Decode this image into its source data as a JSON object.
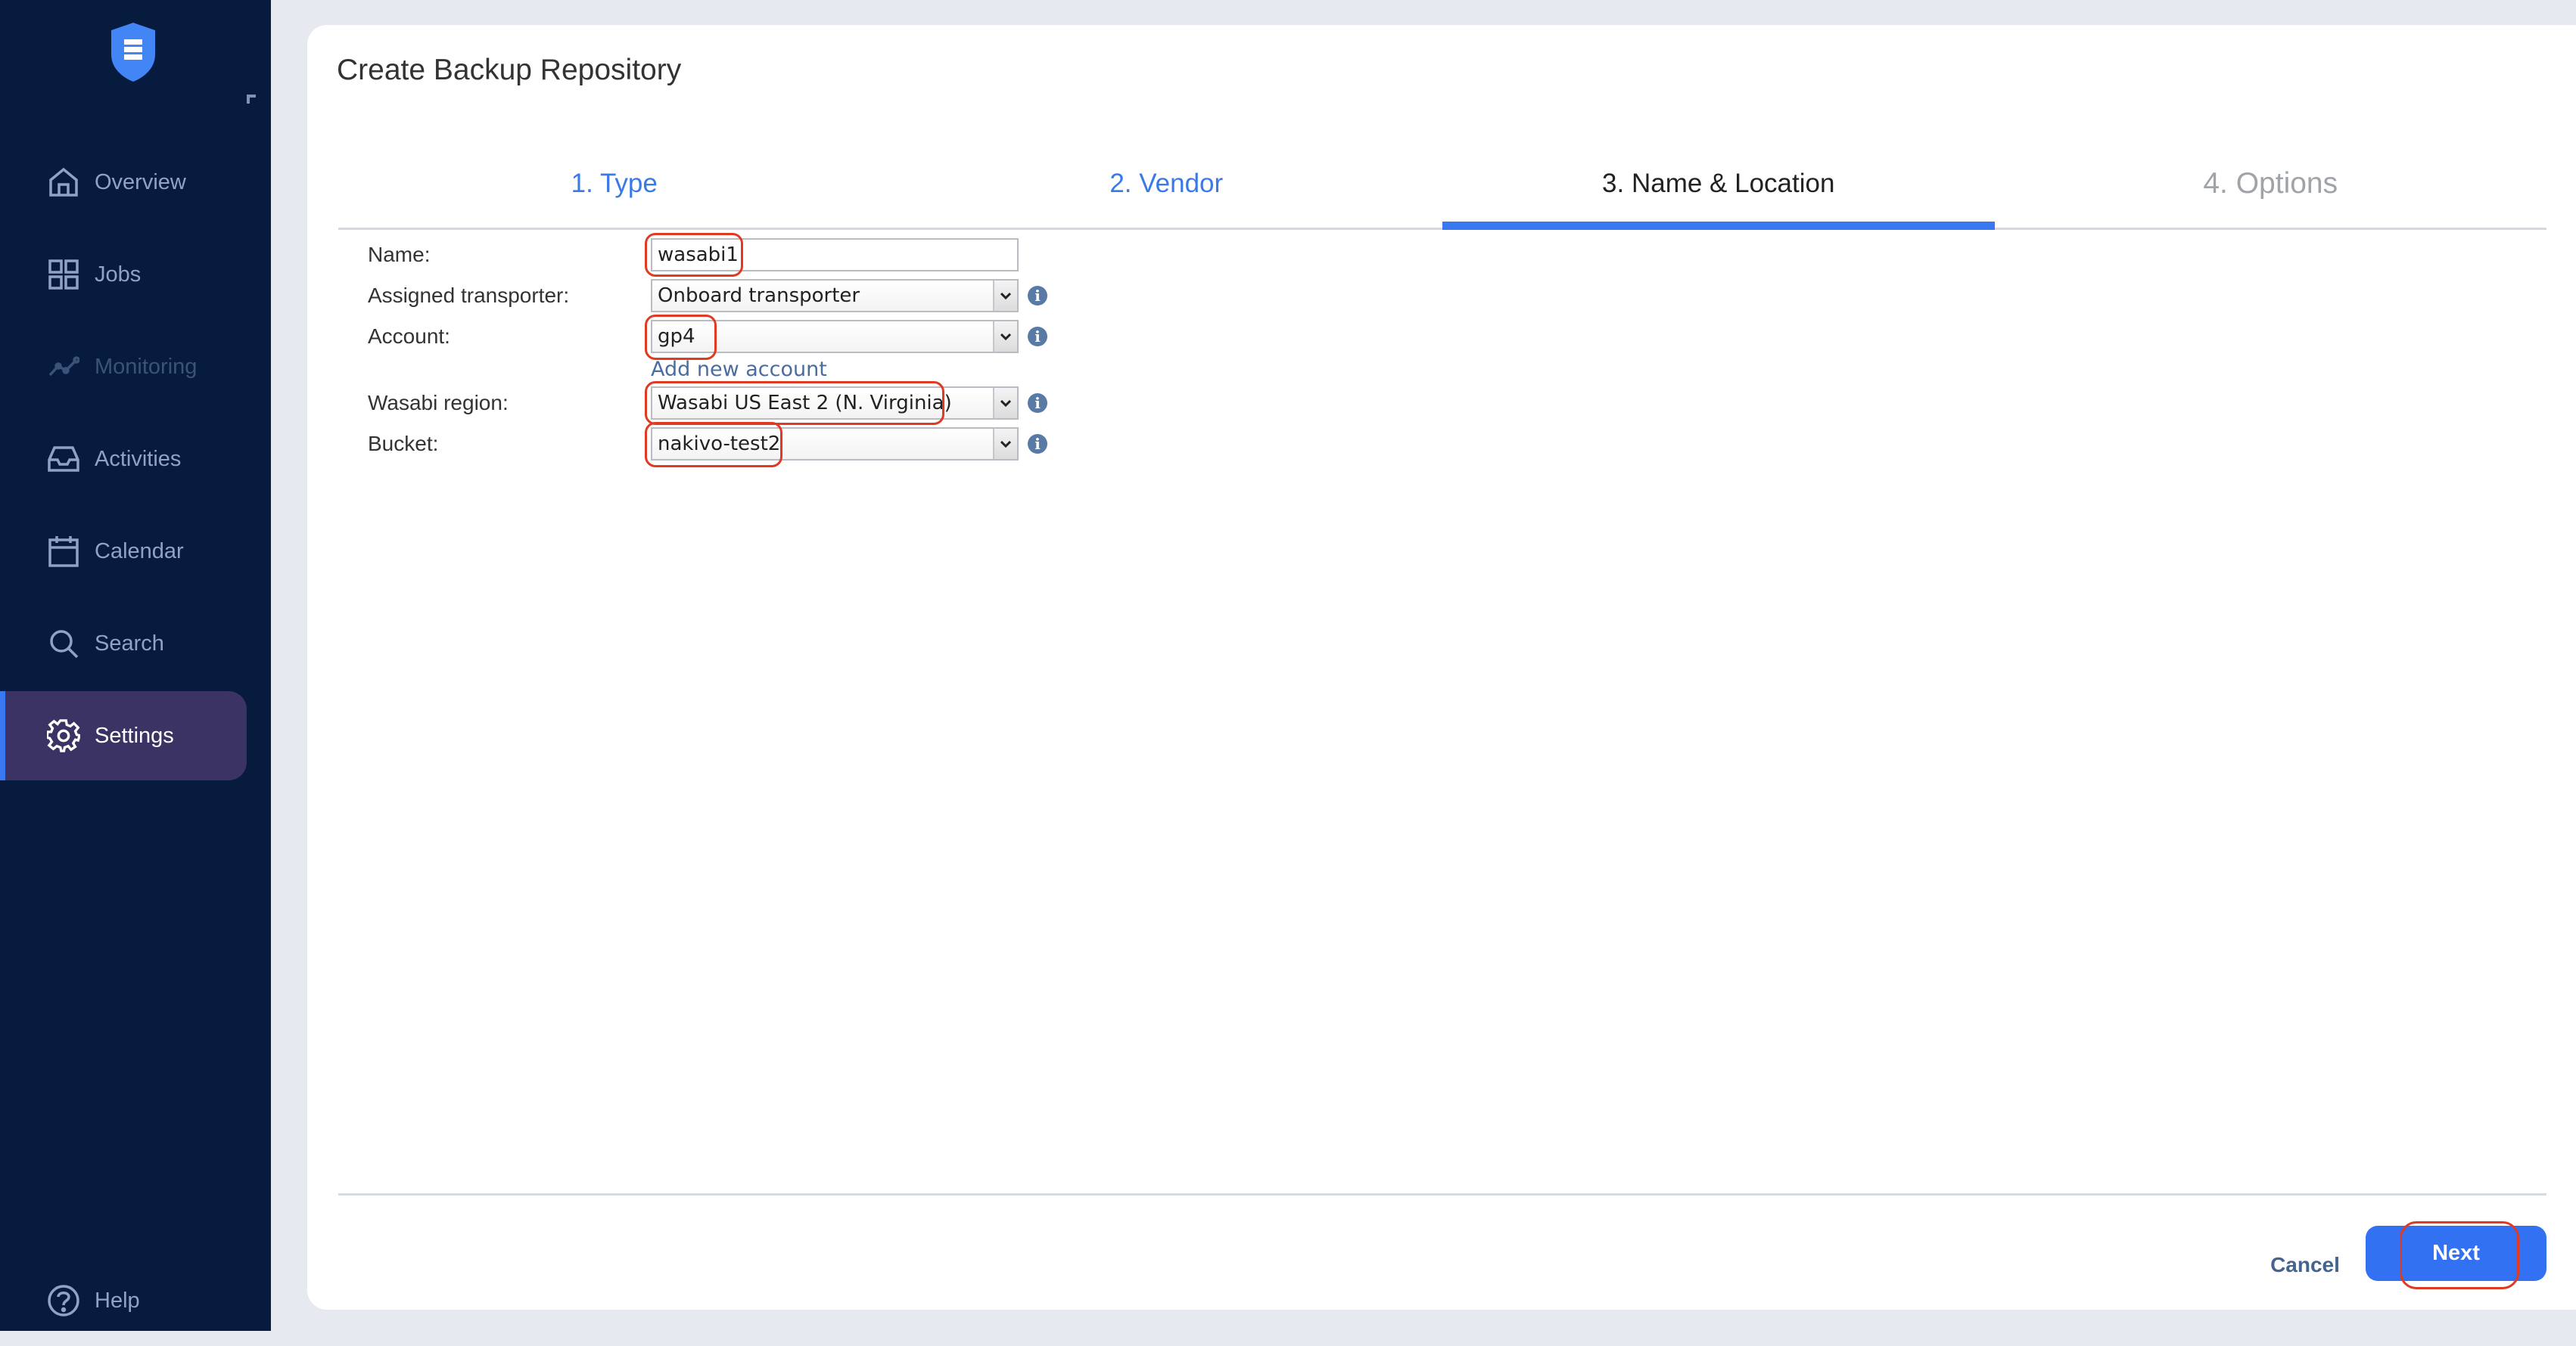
{
  "sidebar": {
    "items": [
      {
        "label": "Overview",
        "icon": "home-icon",
        "state": "normal"
      },
      {
        "label": "Jobs",
        "icon": "grid-icon",
        "state": "normal"
      },
      {
        "label": "Monitoring",
        "icon": "chart-line-icon",
        "state": "disabled"
      },
      {
        "label": "Activities",
        "icon": "inbox-icon",
        "state": "normal"
      },
      {
        "label": "Calendar",
        "icon": "calendar-icon",
        "state": "normal"
      },
      {
        "label": "Search",
        "icon": "search-icon",
        "state": "normal"
      },
      {
        "label": "Settings",
        "icon": "gear-icon",
        "state": "active"
      }
    ],
    "help_label": "Help"
  },
  "dialog": {
    "title": "Create Backup Repository",
    "tabs": [
      {
        "label": "1. Type",
        "state": "completed"
      },
      {
        "label": "2. Vendor",
        "state": "completed"
      },
      {
        "label": "3. Name & Location",
        "state": "active"
      },
      {
        "label": "4. Options",
        "state": "upcoming"
      }
    ],
    "form": {
      "name": {
        "label": "Name:",
        "value": "wasabi1"
      },
      "transporter": {
        "label": "Assigned transporter:",
        "value": "Onboard transporter"
      },
      "account": {
        "label": "Account:",
        "value": "gp4"
      },
      "add_account_link": "Add new account",
      "region": {
        "label": "Wasabi region:",
        "value": "Wasabi US East 2 (N. Virginia)"
      },
      "bucket": {
        "label": "Bucket:",
        "value": "nakivo-test2"
      }
    },
    "footer": {
      "cancel_label": "Cancel",
      "next_label": "Next"
    }
  },
  "colors": {
    "sidebar_bg": "#071b3e",
    "accent": "#3a78f2",
    "highlight": "#e03a22",
    "active_nav_bg": "#3a3363"
  }
}
